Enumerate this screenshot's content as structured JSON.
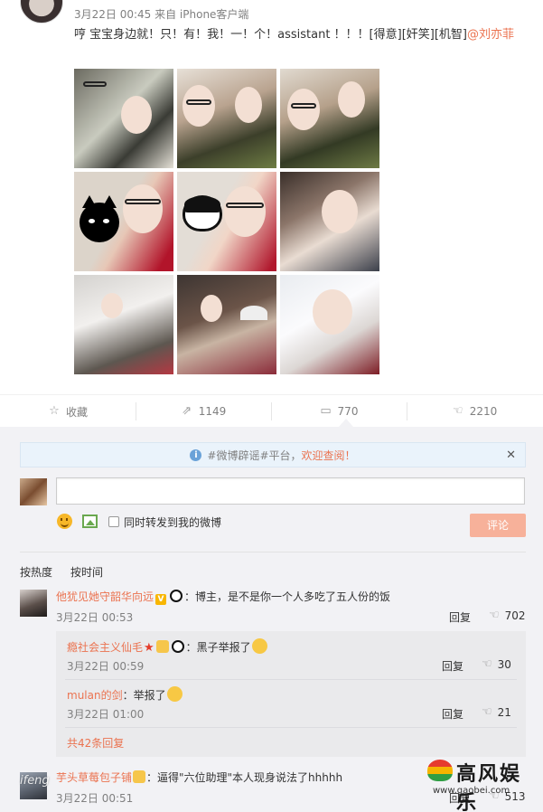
{
  "post": {
    "timestamp": "3月22日 00:45 来自 iPhone客户端",
    "text": "哼 宝宝身边就！只！有！我！一！个！assistant ！！！[得意][奸笑][机智]",
    "mention": "@刘亦菲",
    "photo_count": 9
  },
  "actions": {
    "favorite": "收藏",
    "repost_count": "1149",
    "comment_count": "770",
    "like_count": "2210"
  },
  "notice": {
    "text": "#微博辟谣#平台，",
    "highlight": "欢迎查阅！",
    "close": "✕"
  },
  "composer": {
    "input_value": "",
    "forward_label": "同时转发到我的微博",
    "submit_label": "评论"
  },
  "sort": {
    "hot": "按热度",
    "time": "按时间"
  },
  "comments": [
    {
      "name": "他犹见她守韶华向远",
      "text": "：博主，是不是你一个人多吃了五人份的饭",
      "time": "3月22日 00:53",
      "reply": "回复",
      "likes": "702",
      "replies": [
        {
          "name": "瘾社会主义仙毛",
          "text": "：黑子举报了",
          "time": "3月22日 00:59",
          "reply": "回复",
          "likes": "30"
        },
        {
          "name": "mulan的剑",
          "text": "：举报了",
          "time": "3月22日 01:00",
          "reply": "回复",
          "likes": "21"
        }
      ],
      "more_replies": "共42条回复"
    },
    {
      "name": "芋头草莓包子铺",
      "text": "：逼得\"六位助理\"本人现身说法了hhhhh",
      "time": "3月22日 00:51",
      "reply": "回复",
      "likes": "513"
    }
  ],
  "watermark": {
    "title": "高风娱乐",
    "url": "www.gaobei.com",
    "left_mark": "ifeng"
  },
  "icons": {
    "star": "☆",
    "repost": "⇗",
    "comment": "▭",
    "thumb": "👍"
  },
  "colors": {
    "accent": "#eb7350",
    "submit_bg": "#f7b19a",
    "comment_bg": "#f2f2f5"
  }
}
